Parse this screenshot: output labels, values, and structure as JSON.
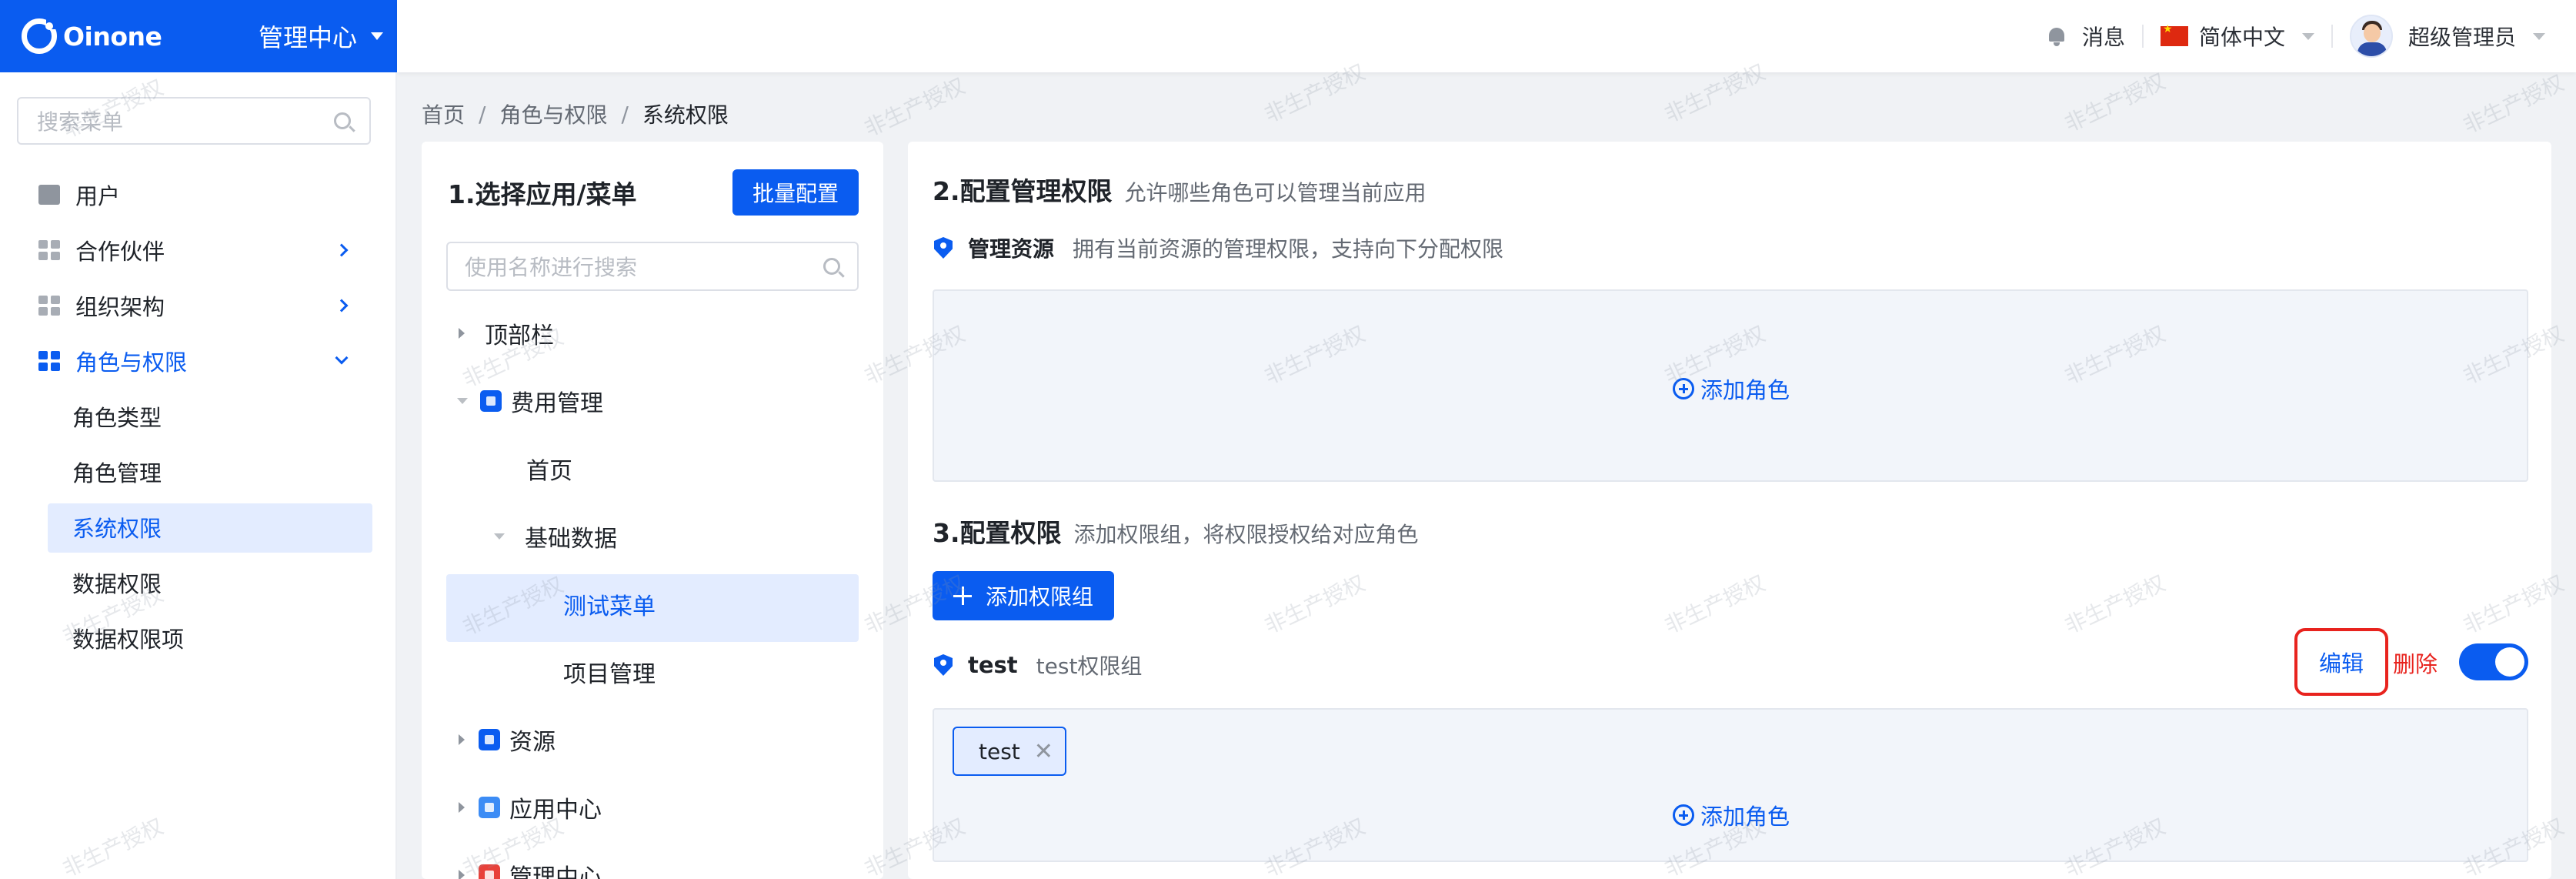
{
  "brand": {
    "logo_text": "Oinone",
    "center_title": "管理中心"
  },
  "topbar": {
    "messages": "消息",
    "language": "简体中文",
    "user_name": "超级管理员"
  },
  "sidebar": {
    "search_placeholder": "搜索菜单",
    "items": [
      {
        "label": "用户"
      },
      {
        "label": "合作伙伴"
      },
      {
        "label": "组织架构"
      },
      {
        "label": "角色与权限"
      }
    ],
    "sub_items": [
      {
        "label": "角色类型"
      },
      {
        "label": "角色管理"
      },
      {
        "label": "系统权限"
      },
      {
        "label": "数据权限"
      },
      {
        "label": "数据权限项"
      }
    ]
  },
  "breadcrumb": {
    "home": "首页",
    "parent": "角色与权限",
    "current": "系统权限",
    "sep": "/"
  },
  "apps_panel": {
    "title": "1.选择应用/菜单",
    "batch_button": "批量配置",
    "search_placeholder": "使用名称进行搜索",
    "tree": {
      "topbar": "顶部栏",
      "fee": "费用管理",
      "home": "首页",
      "base_data": "基础数据",
      "test_menu": "测试菜单",
      "project": "项目管理",
      "resource": "资源",
      "app_center": "应用中心",
      "admin_center": "管理中心"
    }
  },
  "config": {
    "section2_title": "2.配置管理权限",
    "section2_desc": "允许哪些角色可以管理当前应用",
    "manage_res_title": "管理资源",
    "manage_res_desc": "拥有当前资源的管理权限，支持向下分配权限",
    "add_role": "添加角色",
    "section3_title": "3.配置权限",
    "section3_desc": "添加权限组，将权限授权给对应角色",
    "add_group_button": "添加权限组",
    "group_name": "test",
    "group_desc": "test权限组",
    "edit": "编辑",
    "delete": "删除",
    "toggle_on": true,
    "tag": "test",
    "tag_close": "✕",
    "add_role_2": "添加角色"
  },
  "watermark": "非生产授权",
  "colors": {
    "primary": "#0a5cf0",
    "danger": "#e8231e"
  }
}
